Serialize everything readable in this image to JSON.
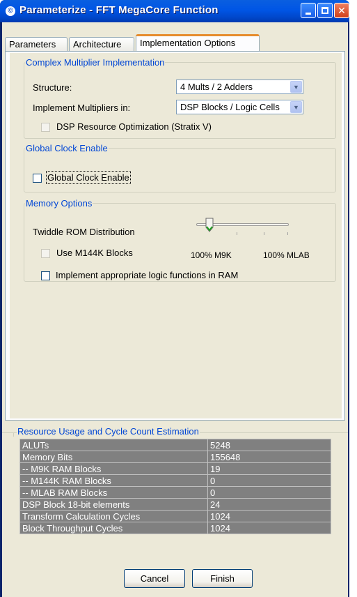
{
  "window": {
    "title": "Parameterize - FFT MegaCore Function",
    "min_label": "_",
    "max_label": "□",
    "close_label": "X"
  },
  "tabs": [
    {
      "label": "Parameters",
      "active": false
    },
    {
      "label": "Architecture",
      "active": false
    },
    {
      "label": "Implementation Options",
      "active": true
    }
  ],
  "complex_multiplier": {
    "title": "Complex Multiplier Implementation",
    "structure_label": "Structure:",
    "structure_value": "4 Mults / 2 Adders",
    "implement_label": "Implement Multipliers in:",
    "implement_value": "DSP Blocks / Logic Cells",
    "dsp_opt_label": "DSP Resource Optimization (Stratix V)",
    "dsp_opt_checked": false,
    "dsp_opt_enabled": false
  },
  "global_clock": {
    "title": "Global Clock Enable",
    "checkbox_label": "Global Clock Enable",
    "checked": false
  },
  "memory": {
    "title": "Memory Options",
    "twiddle_label": "Twiddle ROM Distribution",
    "slider_left_label": "100% M9K",
    "slider_right_label": "100% MLAB",
    "slider_value_fraction": 0,
    "m144k_label": "Use M144K Blocks",
    "m144k_checked": false,
    "ram_logic_label": "Implement appropriate logic functions in RAM",
    "ram_logic_checked": false
  },
  "resources": {
    "title": "Resource Usage and Cycle Count Estimation",
    "rows": [
      {
        "name": "ALUTs",
        "value": "5248"
      },
      {
        "name": "Memory Bits",
        "value": "155648"
      },
      {
        "name": "-- M9K RAM Blocks",
        "value": "19"
      },
      {
        "name": "-- M144K RAM Blocks",
        "value": "0"
      },
      {
        "name": "-- MLAB RAM Blocks",
        "value": "0"
      },
      {
        "name": "DSP Block 18-bit elements",
        "value": "24"
      },
      {
        "name": "Transform Calculation Cycles",
        "value": "1024"
      },
      {
        "name": "Block Throughput Cycles",
        "value": "1024"
      }
    ]
  },
  "buttons": {
    "cancel": "Cancel",
    "finish": "Finish"
  },
  "colors": {
    "titlebar": "#0055e5",
    "group_title": "#0046d5",
    "table_bg": "#808080",
    "dialog_bg": "#ece9d8"
  }
}
